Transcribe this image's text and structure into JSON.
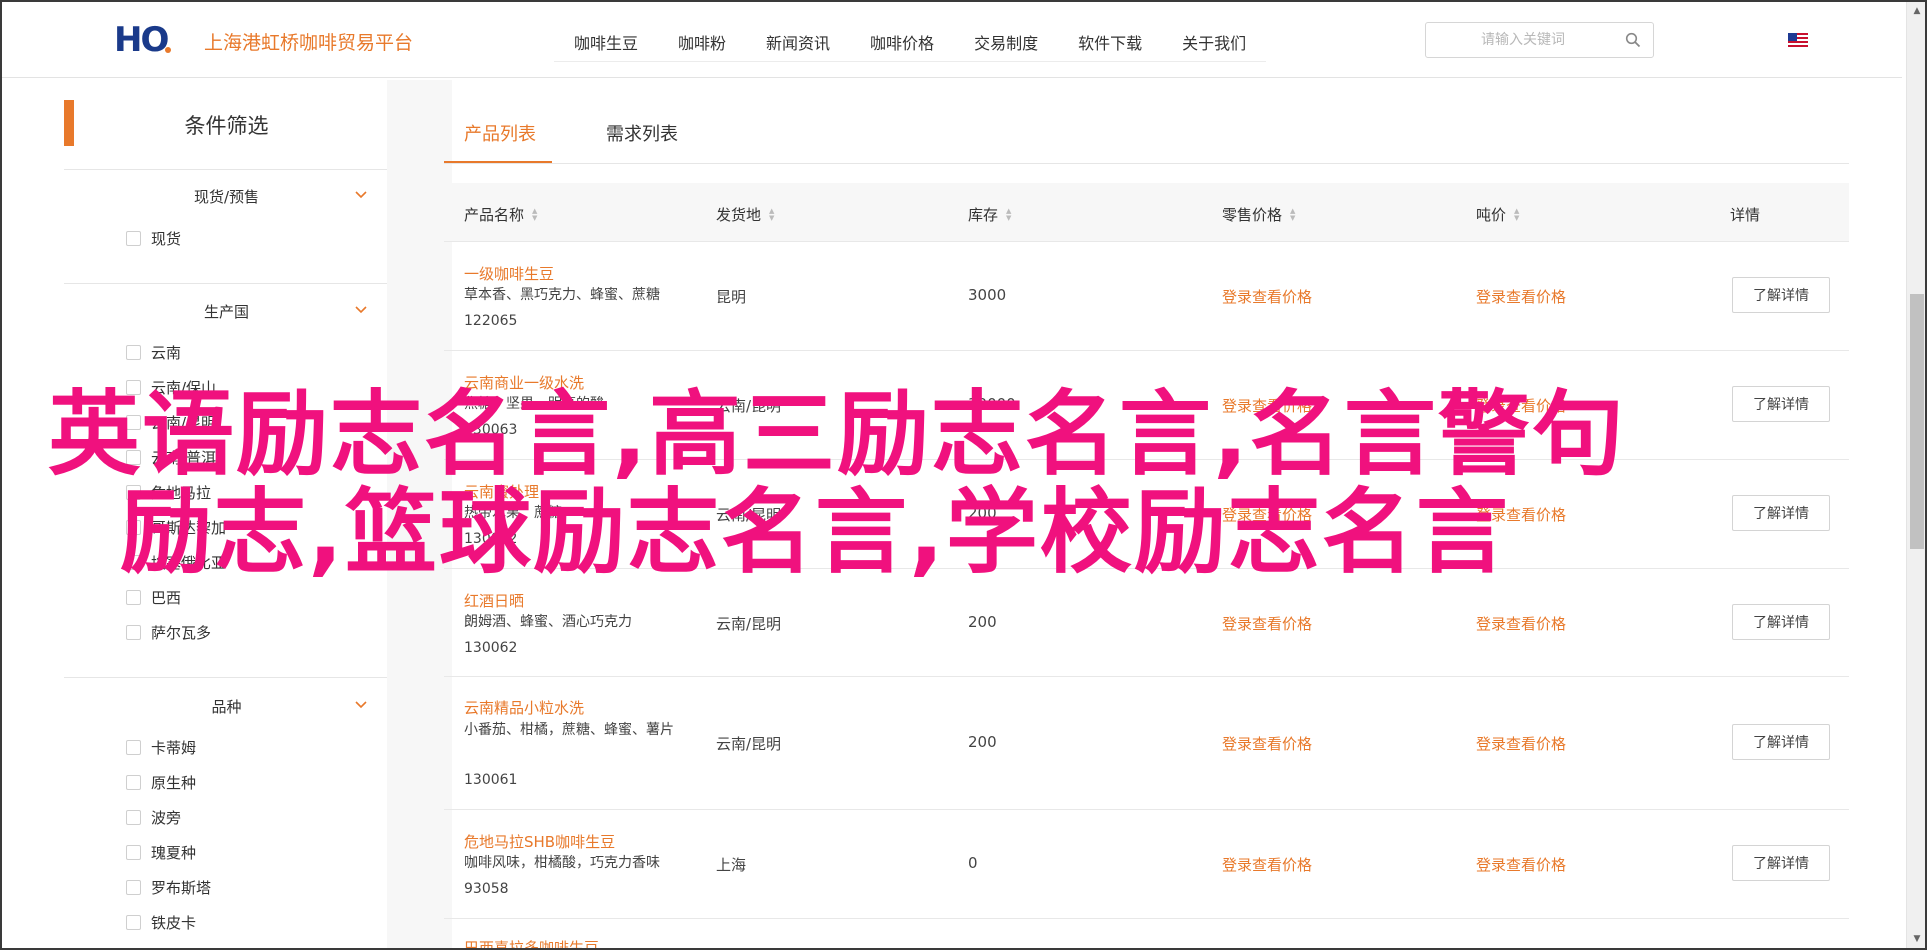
{
  "header": {
    "logo_text": "HO",
    "site_name": "上海港虹桥咖啡贸易平台",
    "nav": [
      "咖啡生豆",
      "咖啡粉",
      "新闻资讯",
      "咖啡价格",
      "交易制度",
      "软件下载",
      "关于我们"
    ],
    "search_placeholder": "请输入关键词",
    "search_icon": "search-icon",
    "flag_icon": "us-flag-icon"
  },
  "sidebar": {
    "title": "条件筛选",
    "groups": [
      {
        "title": "现货/预售",
        "options": [
          "现货"
        ]
      },
      {
        "title": "生产国",
        "options": [
          "云南",
          "云南/保山",
          "云南/昆明",
          "云南/普洱",
          "危地马拉",
          "哥斯达黎加",
          "埃塞俄比亚",
          "巴西",
          "萨尔瓦多"
        ]
      },
      {
        "title": "品种",
        "options": [
          "卡蒂姆",
          "原生种",
          "波旁",
          "瑰夏种",
          "罗布斯塔",
          "铁皮卡"
        ]
      }
    ]
  },
  "tabs": [
    "产品列表",
    "需求列表"
  ],
  "table": {
    "headers": [
      "产品名称",
      "发货地",
      "库存",
      "零售价格",
      "吨价",
      "详情"
    ],
    "rows": [
      {
        "name": "一级咖啡生豆",
        "desc": "草本香、黑巧克力、蜂蜜、蔗糖",
        "code": "122065",
        "origin": "昆明",
        "stock": "3000",
        "retail": "登录查看价格",
        "ton": "登录查看价格",
        "btn": "了解详情"
      },
      {
        "name": "云南商业一级水洗",
        "desc": "焦糖、坚果、明亮的酸",
        "code": "130063",
        "origin": "云南/昆明",
        "stock": "30000",
        "retail": "登录查看价格",
        "ton": "登录查看价格",
        "btn": "了解详情"
      },
      {
        "name": "云南蜜处理",
        "desc": "热带水果、蔗糖",
        "code": "130062",
        "origin": "云南/昆明",
        "stock": "200",
        "retail": "登录查看价格",
        "ton": "登录查看价格",
        "btn": "了解详情"
      },
      {
        "name": "红酒日晒",
        "desc": "朗姆酒、蜂蜜、酒心巧克力",
        "code": "130062",
        "origin": "云南/昆明",
        "stock": "200",
        "retail": "登录查看价格",
        "ton": "登录查看价格",
        "btn": "了解详情"
      },
      {
        "name": "云南精品小粒水洗",
        "desc": "小番茄、柑橘，蔗糖、蜂蜜、薯片",
        "code": "130061",
        "origin": "云南/昆明",
        "stock": "200",
        "retail": "登录查看价格",
        "ton": "登录查看价格",
        "btn": "了解详情"
      },
      {
        "name": "危地马拉SHB咖啡生豆",
        "desc": "咖啡风味，柑橘酸，巧克力香味",
        "code": "93058",
        "origin": "上海",
        "stock": "0",
        "retail": "登录查看价格",
        "ton": "登录查看价格",
        "btn": "了解详情"
      },
      {
        "name": "巴西喜拉多咖啡生豆",
        "desc": "",
        "code": "",
        "origin": "",
        "stock": "",
        "retail": "",
        "ton": "",
        "btn": ""
      }
    ]
  },
  "overlay": {
    "line1": "英语励志名言,高三励志名言,名言警句",
    "line2": "励志,篮球励志名言,学校励志名言",
    "color": "#f0117e"
  },
  "colors": {
    "accent": "#e8792b",
    "logo": "#1a3a8a"
  }
}
